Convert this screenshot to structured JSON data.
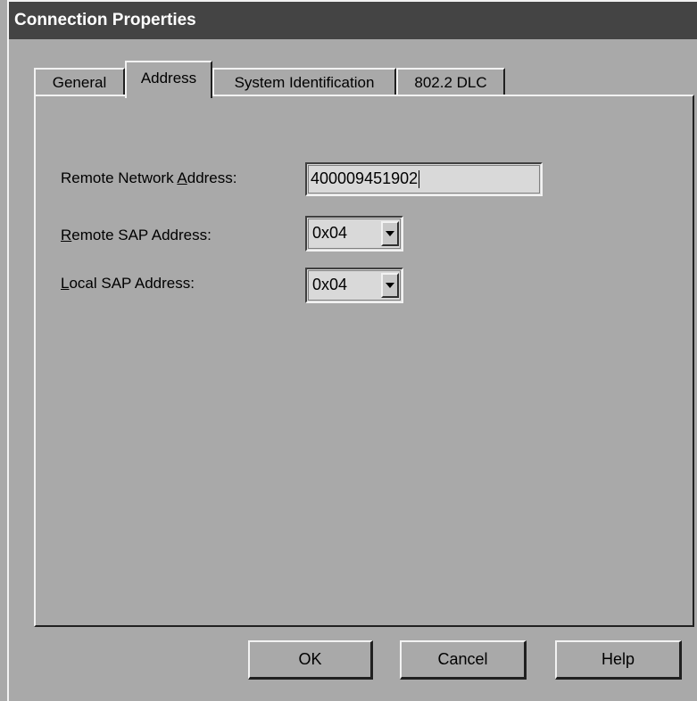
{
  "window": {
    "title": "Connection Properties"
  },
  "tabs": [
    {
      "label": "General",
      "active": false
    },
    {
      "label": "Address",
      "active": true
    },
    {
      "label": "System Identification",
      "active": false
    },
    {
      "label": "802.2 DLC",
      "active": false
    }
  ],
  "fields": {
    "remote_network": {
      "label_pre": "Remote Network ",
      "label_key": "A",
      "label_post": "ddress:",
      "value": "400009451902"
    },
    "remote_sap": {
      "label_key": "R",
      "label_post": "emote SAP Address:",
      "value": "0x04"
    },
    "local_sap": {
      "label_key": "L",
      "label_post": "ocal SAP Address:",
      "value": "0x04"
    }
  },
  "buttons": {
    "ok": "OK",
    "cancel": "Cancel",
    "help": "Help"
  },
  "icons": {
    "dropdown": "chevron-down-icon"
  }
}
